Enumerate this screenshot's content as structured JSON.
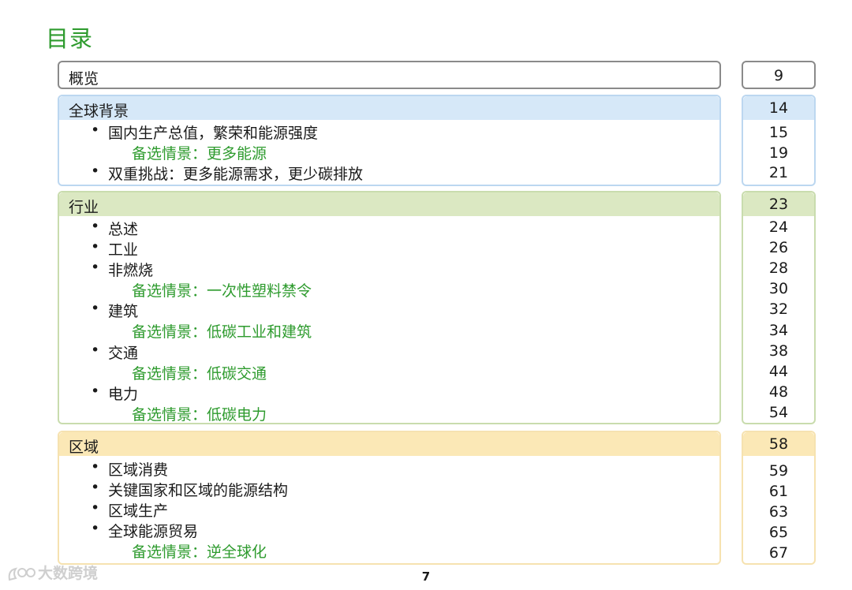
{
  "title": "目录",
  "page_number": "7",
  "watermark": "大数跨境",
  "colors": {
    "green_text": "#2e9b2e",
    "blue_header": "#d6e8f8",
    "blue_border": "#bcd7f0",
    "green_header": "#dbe8c2",
    "green_border": "#c9dcae",
    "yellow_header": "#fbe8b6",
    "yellow_border": "#f6e2b0"
  },
  "overview": {
    "label": "概览",
    "page": "9"
  },
  "sections": [
    {
      "title": "全球背景",
      "page": "14",
      "items": [
        {
          "text": "国内生产总值，繁荣和能源强度",
          "page": "15",
          "kind": "bullet"
        },
        {
          "text": "备选情景：更多能源",
          "page": "19",
          "kind": "scenario"
        },
        {
          "text": "双重挑战：更多能源需求，更少碳排放",
          "page": "21",
          "kind": "bullet"
        }
      ]
    },
    {
      "title": "行业",
      "page": "23",
      "items": [
        {
          "text": "总述",
          "page": "24",
          "kind": "bullet"
        },
        {
          "text": "工业",
          "page": "26",
          "kind": "bullet"
        },
        {
          "text": "非燃烧",
          "page": "28",
          "kind": "bullet"
        },
        {
          "text": "备选情景：一次性塑料禁令",
          "page": "30",
          "kind": "scenario"
        },
        {
          "text": "建筑",
          "page": "32",
          "kind": "bullet"
        },
        {
          "text": "备选情景：低碳工业和建筑",
          "page": "34",
          "kind": "scenario"
        },
        {
          "text": "交通",
          "page": "38",
          "kind": "bullet"
        },
        {
          "text": "备选情景：低碳交通",
          "page": "44",
          "kind": "scenario"
        },
        {
          "text": "电力",
          "page": "48",
          "kind": "bullet"
        },
        {
          "text": "备选情景：低碳电力",
          "page": "54",
          "kind": "scenario"
        }
      ]
    },
    {
      "title": "区域",
      "page": "58",
      "items": [
        {
          "text": "区域消费",
          "page": "59",
          "kind": "bullet"
        },
        {
          "text": "关键国家和区域的能源结构",
          "page": "61",
          "kind": "bullet"
        },
        {
          "text": "区域生产",
          "page": "63",
          "kind": "bullet"
        },
        {
          "text": "全球能源贸易",
          "page": "65",
          "kind": "bullet"
        },
        {
          "text": "备选情景：逆全球化",
          "page": "67",
          "kind": "scenario"
        }
      ]
    }
  ]
}
